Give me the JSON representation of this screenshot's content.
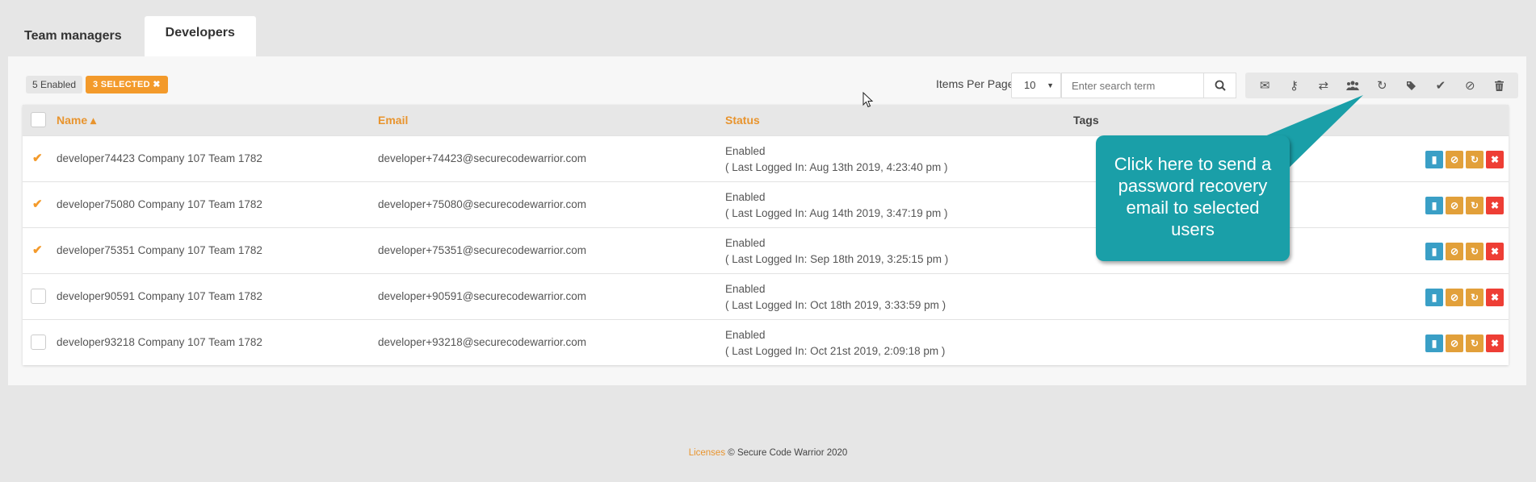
{
  "tabs": [
    {
      "label": "Team managers"
    },
    {
      "label": "Developers"
    }
  ],
  "badges": {
    "enabled": "5 Enabled",
    "selected": "3 SELECTED ✖"
  },
  "controls": {
    "items_per_page_label": "Items Per Page:",
    "items_per_page_value": "10",
    "search_placeholder": "Enter search term"
  },
  "toolbar": {
    "icons": [
      "envelope-icon",
      "key-icon",
      "transfer-icon",
      "users-icon",
      "refresh-icon",
      "tag-icon",
      "check-icon",
      "ban-icon",
      "trash-icon"
    ]
  },
  "table": {
    "headers": {
      "name": "Name ▴",
      "email": "Email",
      "status": "Status",
      "tags": "Tags"
    },
    "rows": [
      {
        "selected": true,
        "name": "developer74423 Company 107 Team 1782",
        "email": "developer+74423@securecodewarrior.com",
        "status": "Enabled",
        "last_login": "( Last Logged In: Aug 13th 2019, 4:23:40 pm )"
      },
      {
        "selected": true,
        "name": "developer75080 Company 107 Team 1782",
        "email": "developer+75080@securecodewarrior.com",
        "status": "Enabled",
        "last_login": "( Last Logged In: Aug 14th 2019, 3:47:19 pm )"
      },
      {
        "selected": true,
        "name": "developer75351 Company 107 Team 1782",
        "email": "developer+75351@securecodewarrior.com",
        "status": "Enabled",
        "last_login": "( Last Logged In: Sep 18th 2019, 3:25:15 pm )"
      },
      {
        "selected": false,
        "name": "developer90591 Company 107 Team 1782",
        "email": "developer+90591@securecodewarrior.com",
        "status": "Enabled",
        "last_login": "( Last Logged In: Oct 18th 2019, 3:33:59 pm )"
      },
      {
        "selected": false,
        "name": "developer93218 Company 107 Team 1782",
        "email": "developer+93218@securecodewarrior.com",
        "status": "Enabled",
        "last_login": "( Last Logged In: Oct 21st 2019, 2:09:18 pm )"
      }
    ]
  },
  "callout": {
    "text": "Click here to send a password recovery email to selected users"
  },
  "footer": {
    "link": "Licenses",
    "copyright": "© Secure Code Warrior 2020"
  },
  "colors": {
    "accent": "#f39a2b",
    "callout": "#1a9fa8",
    "action_blue": "#3a9fc6",
    "action_gold": "#e2a03a",
    "action_red": "#ee3e35"
  }
}
